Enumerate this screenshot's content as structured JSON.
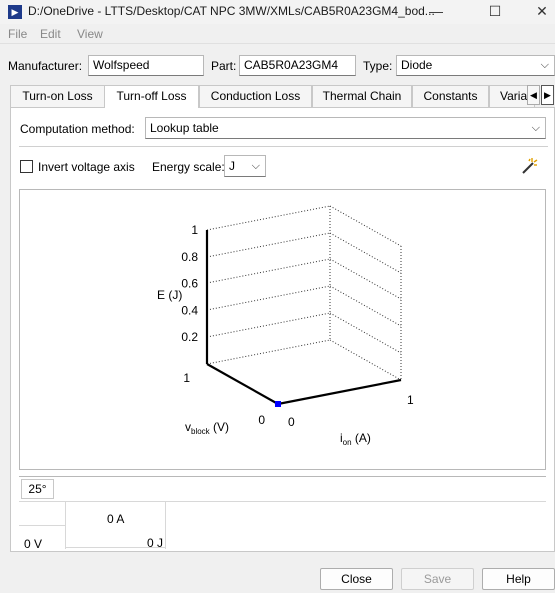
{
  "window": {
    "title": "D:/OneDrive - LTTS/Desktop/CAT NPC 3MW/XMLs/CAB5R0A23GM4_bod...",
    "minimize": "—",
    "maximize": "☐",
    "close": "✕"
  },
  "menu": {
    "file": "File",
    "edit": "Edit",
    "view": "View"
  },
  "meta": {
    "manufacturer_label": "Manufacturer:",
    "manufacturer_value": "Wolfspeed",
    "part_label": "Part:",
    "part_value": "CAB5R0A23GM4",
    "type_label": "Type:",
    "type_value": "Diode"
  },
  "tabs": [
    "Turn-on Loss",
    "Turn-off Loss",
    "Conduction Loss",
    "Thermal Chain",
    "Constants",
    "Varia"
  ],
  "active_tab": "Turn-off Loss",
  "computation": {
    "label": "Computation method:",
    "value": "Lookup table"
  },
  "options": {
    "invert_label": "Invert voltage axis",
    "invert_checked": false,
    "energy_scale_label": "Energy scale:",
    "energy_scale_value": "J"
  },
  "chart_data": {
    "type": "surface3d",
    "zlabel": "E (J)",
    "z_ticks": [
      "1",
      "0.8",
      "0.6",
      "0.4",
      "0.2"
    ],
    "xlabel_main": "v",
    "xlabel_sub": "block",
    "xlabel_unit": "(V)",
    "ylabel_main": "i",
    "ylabel_sub": "on",
    "ylabel_unit": "(A)",
    "v_ticks": [
      "1",
      "0"
    ],
    "i_ticks": [
      "0",
      "1"
    ],
    "points": [
      {
        "v_block": 0,
        "i_on": 0,
        "E": 0
      }
    ]
  },
  "table": {
    "temp_tab": "25°",
    "col_header": "0 A",
    "row_header": "0 V",
    "cell": "0 J"
  },
  "buttons": {
    "close": "Close",
    "save": "Save",
    "help": "Help"
  }
}
